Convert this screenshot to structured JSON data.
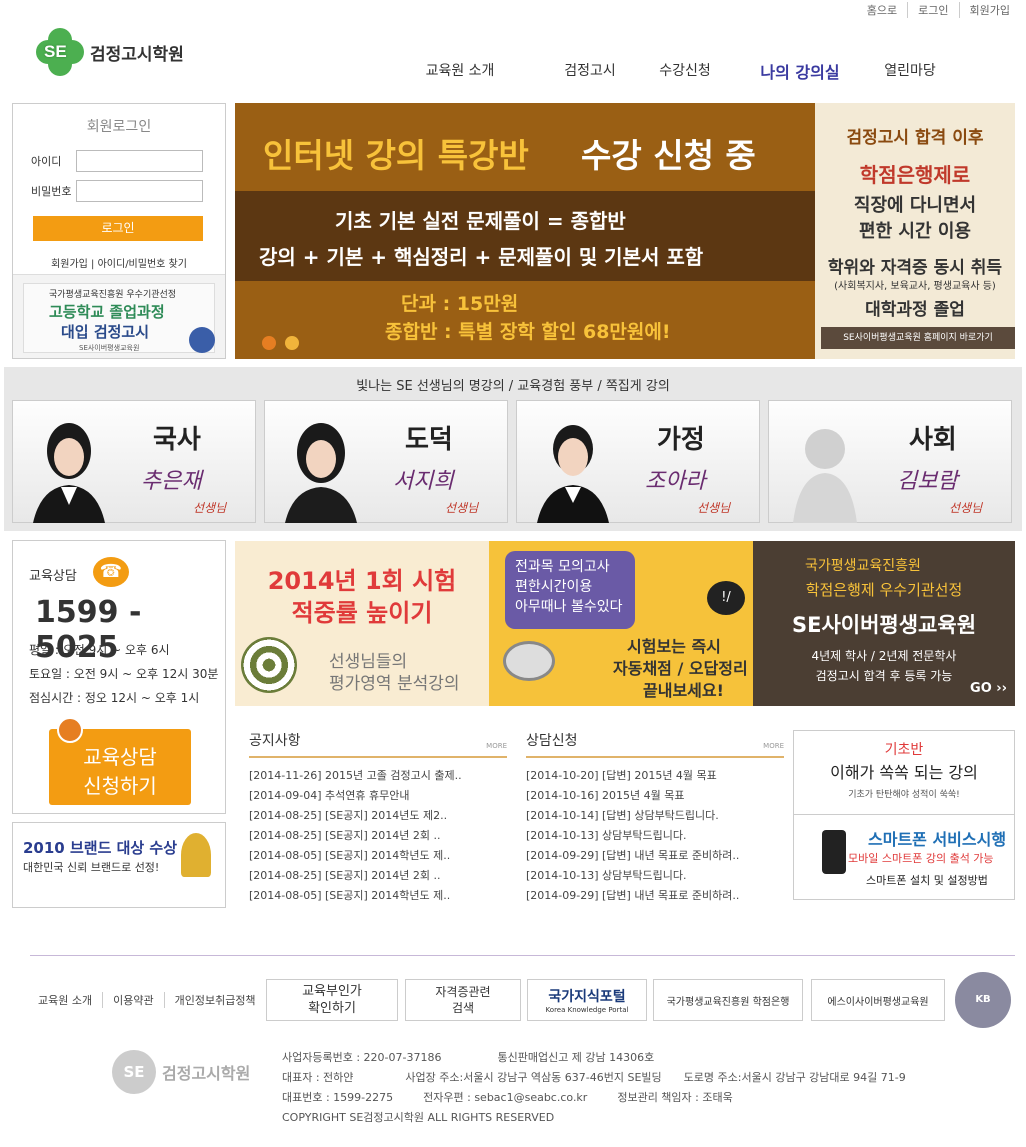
{
  "top_links": [
    "홈으로",
    "로그인",
    "회원가입"
  ],
  "logo": {
    "mark": "SE",
    "name": "검정고시학원"
  },
  "nav": [
    "교육원 소개",
    "검정고시",
    "수강신청",
    "나의 강의실",
    "열린마당"
  ],
  "login": {
    "title": "회원로그인",
    "id_label": "아이디",
    "pw_label": "비밀번호",
    "button": "로그인",
    "links": "회원가입 | 아이디/비밀번호 찾기"
  },
  "side_banner": {
    "org": "국가평생교육진흥원 우수기관선정",
    "line1": "고등학교 졸업과정",
    "line2": "대입 검정고시",
    "brand": "SE사이버평생교육원"
  },
  "hero": {
    "title_a": "인터넷 강의 특강반",
    "title_b": "수강 신청 중",
    "line1": "기초 기본 실전 문제풀이 = 종합반",
    "line2": "강의 + 기본 + 핵심정리 + 문제풀이 및 기본서 포함",
    "price1": "단과 : 15만원",
    "price2": "종합반 : 특별 장학 할인 68만원에!",
    "r1": "검정고시 합격 이후",
    "r2": "학점은행제로",
    "r3": "직장에 다니면서",
    "r4": "편한 시간 이용",
    "r5": "학위와 자격증 동시 취득",
    "r6": "(사회복지사, 보육교사, 평생교육사 등)",
    "r7": "대학과정 졸업",
    "r8": "SE사이버평생교육원 홈페이지 바로가기"
  },
  "teachers_caption": "빛나는 SE 선생님의 명강의 / 교육경험 풍부 / 쪽집게 강의",
  "teachers": [
    {
      "subject": "국사",
      "name": "추은재",
      "suffix": "선생님"
    },
    {
      "subject": "도덕",
      "name": "서지희",
      "suffix": "선생님"
    },
    {
      "subject": "가정",
      "name": "조아라",
      "suffix": "선생님"
    },
    {
      "subject": "사회",
      "name": "김보람",
      "suffix": "선생님"
    }
  ],
  "consult": {
    "title": "교육상담",
    "phone": "1599 - 5025",
    "h1": "평일 : 오전 9시 ~ 오후 6시",
    "h2": "토요일 : 오전 9시 ~ 오후 12시 30분",
    "h3": "점심시간 : 정오 12시 ~ 오후 1시",
    "btn1": "교육상담",
    "btn2": "신청하기"
  },
  "brand_award": {
    "line1": "2010 브랜드 대상 수상",
    "line2": "대한민국 신뢰 브랜드로 선정!"
  },
  "promo1": {
    "t1": "2014년 1회 시험",
    "t2": "적중률 높이기",
    "s1": "선생님들의",
    "s2": "평가영역 분석강의"
  },
  "promo2": {
    "b1": "전과목 모의고사",
    "b2": "편한시간이용",
    "b3": "아무때나 볼수있다",
    "t1": "시험보는 즉시",
    "t2": "자동채점 / 오답정리",
    "t3": "끝내보세요!"
  },
  "promo3": {
    "o1": "국가평생교육진흥원",
    "o2": "학점은행제 우수기관선정",
    "t": "SE사이버평생교육원",
    "d1": "4년제 학사 / 2년제 전문학사",
    "d2": "검정고시 합격 후 등록 가능",
    "go": "GO ››"
  },
  "notice": {
    "title": "공지사항",
    "more": "MORE",
    "items": [
      "[2014-11-26] 2015년 고졸 검정고시 출제..",
      "[2014-09-04] 추석연휴 휴무안내",
      "[2014-08-25] [SE공지] 2014년도 제2..",
      "[2014-08-25] [SE공지] 2014년 2회 ..",
      "[2014-08-05] [SE공지] 2014학년도 제..",
      "[2014-08-25] [SE공지] 2014년 2회 ..",
      "[2014-08-05] [SE공지] 2014학년도 제.."
    ]
  },
  "qna": {
    "title": "상담신청",
    "more": "MORE",
    "items": [
      "[2014-10-20] [답변] 2015년 4월 목표",
      "[2014-10-16] 2015년 4월 목표",
      "[2014-10-14] [답변] 상담부탁드립니다.",
      "[2014-10-13] 상담부탁드립니다.",
      "[2014-09-29] [답변] 내년 목표로 준비하려..",
      "[2014-10-13] 상담부탁드립니다.",
      "[2014-09-29] [답변] 내년 목표로 준비하려.."
    ]
  },
  "side": {
    "a1": "기초반",
    "a2": "이해가 쏙쏙 되는 강의",
    "a3": "기초가 탄탄해야 성적이 쑥쑥!",
    "b1": "스마트폰 서비스시행",
    "b2": "모바일 스마트폰 강의 출석 가능",
    "b3": "스마트폰 설치 및 설정방법"
  },
  "footer": {
    "links": [
      "교육원 소개",
      "이용약관",
      "개인정보취급정책"
    ],
    "btn1a": "교육부인가",
    "btn1b": "확인하기",
    "btn2a": "자격증관련",
    "btn2b": "검색",
    "btn3a": "국가지식포털",
    "btn3b": "Korea Knowledge Portal",
    "btn4": "국가평생교육진흥원 학점은행",
    "btn5": "에스이사이버평생교육원",
    "seal": "KB",
    "logo_name": "검정고시학원",
    "i1": "사업자등록번호 : 220-07-37186",
    "i2": "통신판매업신고 제 강남 14306호",
    "i3": "대표자 : 전하얀",
    "i4": "사업장 주소:서울시 강남구 역삼동 637-46번지 SE빌딩",
    "i5": "도로명 주소:서울시 강남구 강남대로 94길 71-9",
    "i6": "대표번호 : 1599-2275",
    "i7": "전자우편 : sebac1@seabc.co.kr",
    "i8": "정보관리 책임자 : 조태욱",
    "i9": "COPYRIGHT  SE검정고시학원   ALL RIGHTS RESERVED"
  },
  "colors": {
    "orange": "#f39c12",
    "nav_active": "#3a3aa0",
    "hero_brown": "#9a5f14"
  }
}
